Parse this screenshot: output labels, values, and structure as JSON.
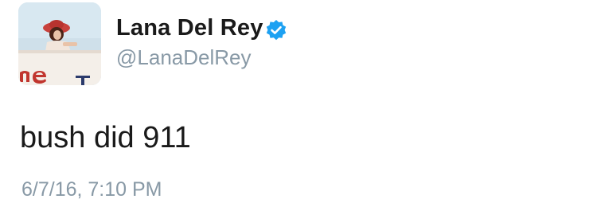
{
  "author": {
    "display_name": "Lana Del Rey",
    "handle": "@LanaDelRey",
    "verified": true,
    "avatar_icon": "profile-photo"
  },
  "tweet": {
    "text": "bush did 911",
    "timestamp": "6/7/16, 7:10 PM"
  },
  "colors": {
    "name": "#1a1a1a",
    "secondary": "#8899a6",
    "verified_badge": "#1da1f2"
  }
}
